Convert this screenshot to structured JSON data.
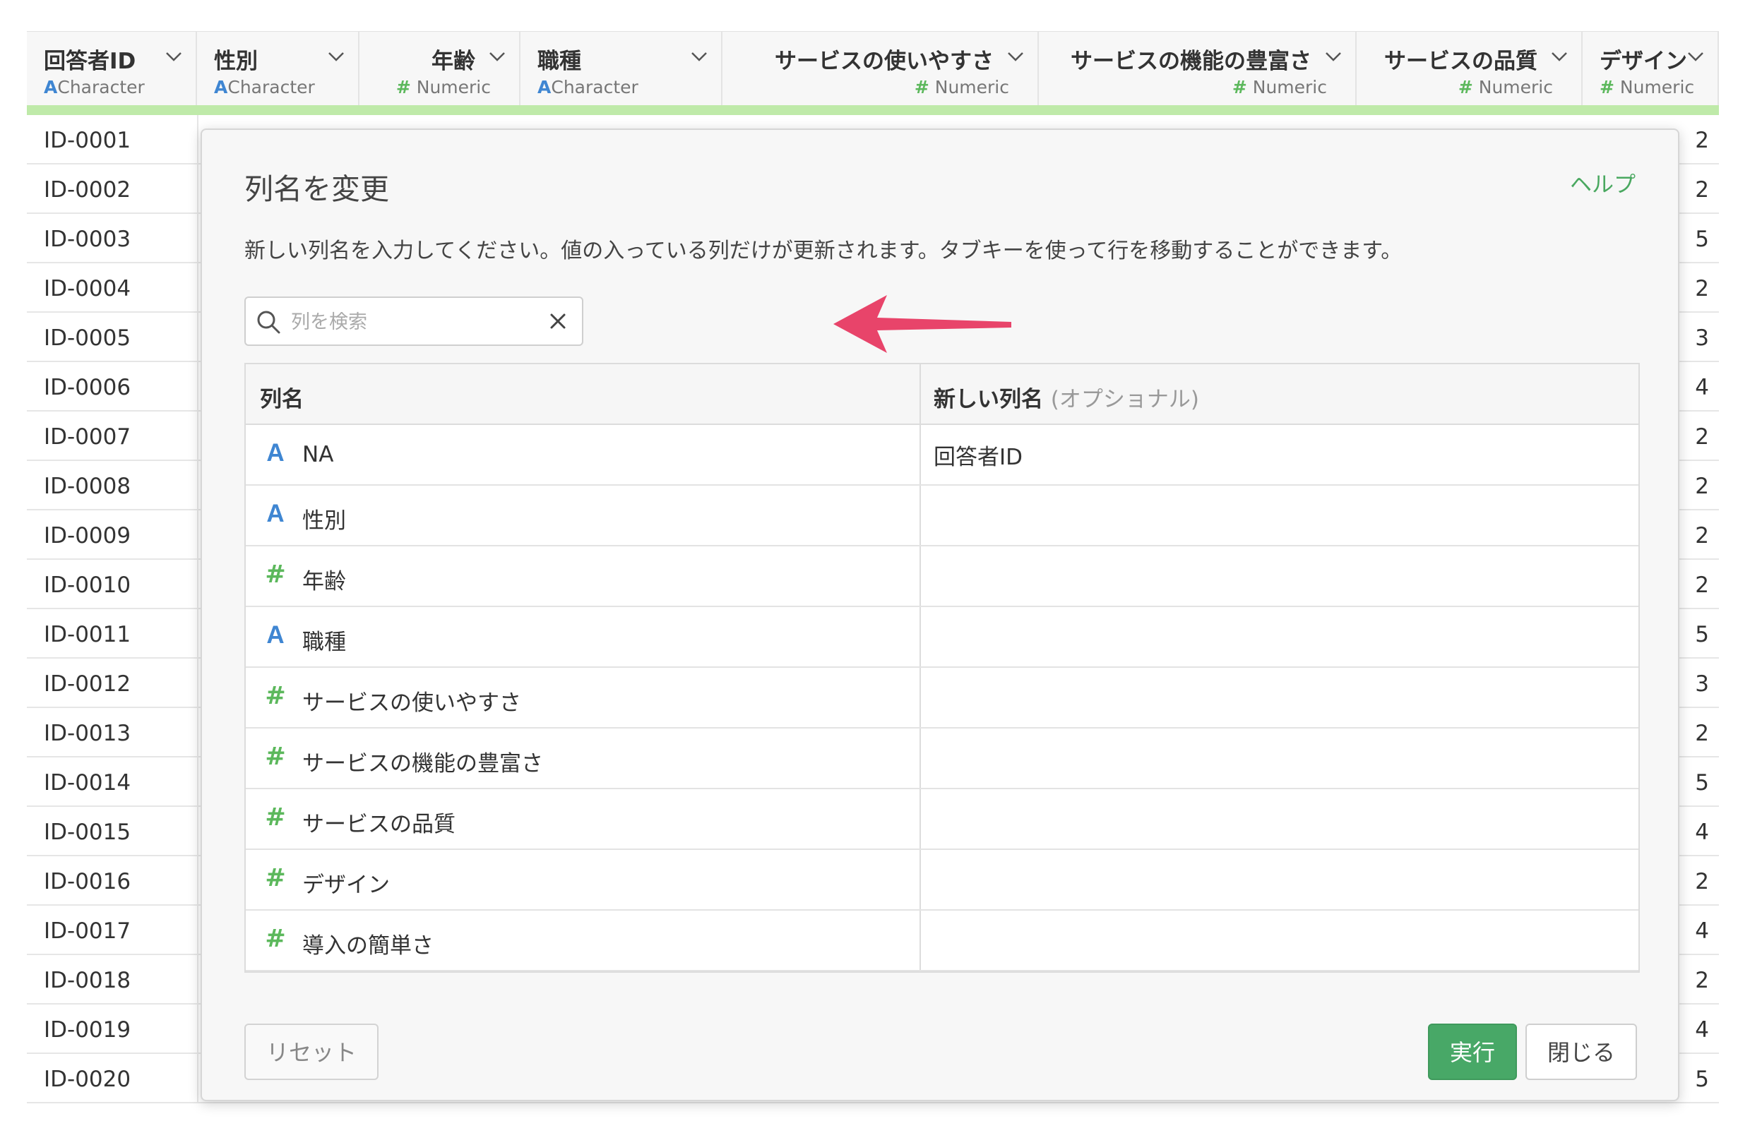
{
  "grid": {
    "columns": [
      {
        "name": "回答者ID",
        "type": "Character",
        "type_icon": "A",
        "align": "left"
      },
      {
        "name": "性別",
        "type": "Character",
        "type_icon": "A",
        "align": "left"
      },
      {
        "name": "年齢",
        "type": "Numeric",
        "type_icon": "#",
        "align": "right"
      },
      {
        "name": "職種",
        "type": "Character",
        "type_icon": "A",
        "align": "left"
      },
      {
        "name": "サービスの使いやすさ",
        "type": "Numeric",
        "type_icon": "#",
        "align": "right"
      },
      {
        "name": "サービスの機能の豊富さ",
        "type": "Numeric",
        "type_icon": "#",
        "align": "right"
      },
      {
        "name": "サービスの品質",
        "type": "Numeric",
        "type_icon": "#",
        "align": "right"
      },
      {
        "name": "デザイン",
        "type": "Numeric",
        "type_icon": "#",
        "align": "left"
      }
    ],
    "rows": [
      {
        "id": "ID-0001",
        "last": "2"
      },
      {
        "id": "ID-0002",
        "last": "2"
      },
      {
        "id": "ID-0003",
        "last": "5"
      },
      {
        "id": "ID-0004",
        "last": "2"
      },
      {
        "id": "ID-0005",
        "last": "3"
      },
      {
        "id": "ID-0006",
        "last": "4"
      },
      {
        "id": "ID-0007",
        "last": "2"
      },
      {
        "id": "ID-0008",
        "last": "2"
      },
      {
        "id": "ID-0009",
        "last": "2"
      },
      {
        "id": "ID-0010",
        "last": "2"
      },
      {
        "id": "ID-0011",
        "last": "5"
      },
      {
        "id": "ID-0012",
        "last": "3"
      },
      {
        "id": "ID-0013",
        "last": "2"
      },
      {
        "id": "ID-0014",
        "last": "5"
      },
      {
        "id": "ID-0015",
        "last": "4"
      },
      {
        "id": "ID-0016",
        "last": "2"
      },
      {
        "id": "ID-0017",
        "last": "4"
      },
      {
        "id": "ID-0018",
        "last": "2"
      },
      {
        "id": "ID-0019",
        "last": "4"
      },
      {
        "id": "ID-0020",
        "last": "5"
      }
    ]
  },
  "dialog": {
    "title": "列名を変更",
    "help": "ヘルプ",
    "description": "新しい列名を入力してください。値の入っている列だけが更新されます。タブキーを使って行を移動することができます。",
    "search_placeholder": "列を検索",
    "table_header_left": "列名",
    "table_header_right": "新しい列名",
    "table_header_right_optional": "(オプショナル)",
    "rows": [
      {
        "type_icon": "A",
        "name": "NA",
        "new_name": "回答者ID"
      },
      {
        "type_icon": "A",
        "name": "性別",
        "new_name": ""
      },
      {
        "type_icon": "#",
        "name": "年齢",
        "new_name": ""
      },
      {
        "type_icon": "A",
        "name": "職種",
        "new_name": ""
      },
      {
        "type_icon": "#",
        "name": "サービスの使いやすさ",
        "new_name": ""
      },
      {
        "type_icon": "#",
        "name": "サービスの機能の豊富さ",
        "new_name": ""
      },
      {
        "type_icon": "#",
        "name": "サービスの品質",
        "new_name": ""
      },
      {
        "type_icon": "#",
        "name": "デザイン",
        "new_name": ""
      },
      {
        "type_icon": "#",
        "name": "導入の簡単さ",
        "new_name": ""
      }
    ],
    "buttons": {
      "reset": "リセット",
      "run": "実行",
      "close": "閉じる"
    }
  },
  "colors": {
    "accent_green": "#48a867",
    "character_blue": "#3f86d2",
    "numeric_green": "#5cb85c",
    "annotation_arrow": "#e8446a",
    "header_underline": "#bfeaa9"
  }
}
